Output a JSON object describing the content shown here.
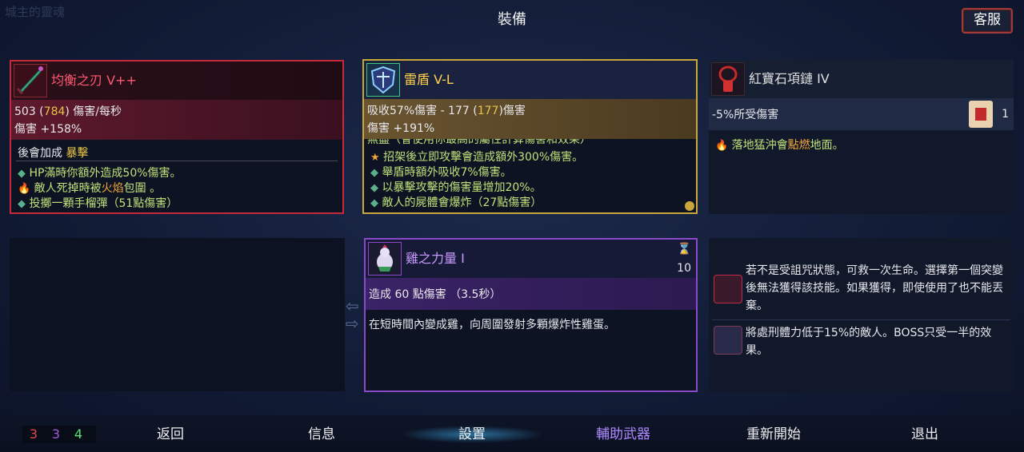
{
  "ghost_title": "城主的靈魂",
  "screen_title": "裝備",
  "support_button": "客服",
  "weapon": {
    "name": "均衡之刃 V++",
    "dps_base": "503",
    "dps_open": " (",
    "dps_value": "784",
    "dps_close": ") 傷害/每秒",
    "damage_bonus": "傷害 +158%",
    "bonus_label": "後會加成 ",
    "bonus_value": "暴擊",
    "effects": [
      {
        "prefix": "HP滿時你額外造成50%傷害。",
        "hl": "",
        "suffix": ""
      },
      {
        "prefix": "敵人死掉時被",
        "hl": "火焰",
        "suffix": "包圍 。"
      },
      {
        "prefix": "投擲一顆手榴彈（51點傷害）",
        "hl": "",
        "suffix": ""
      }
    ]
  },
  "shield": {
    "name": "雷盾 V-L",
    "absorb_a": "吸收57%傷害 - 177 (",
    "absorb_value": "177",
    "absorb_b": ")傷害",
    "damage_bonus": "傷害 +191%",
    "cutoff_line": "無盡（會使用你最高的屬性計算傷害和效果）",
    "effects": [
      "招架後立即攻擊會造成額外300%傷害。",
      "舉盾時額外吸收7%傷害。",
      "以暴擊攻擊的傷害量增加20%。",
      "敵人的屍體會爆炸（27點傷害）"
    ]
  },
  "amulet": {
    "name": "紅寶石項鏈 IV",
    "stat": "-5%所受傷害",
    "scroll_count": "1",
    "effect_a": "落地猛沖會",
    "effect_hl": "點燃",
    "effect_b": "地面。"
  },
  "skill": {
    "name": "雞之力量 I",
    "cooldown": "10",
    "damage": "造成 60 點傷害 （3.5秒）",
    "description": "在短時間內變成雞，向周圍發射多顆爆炸性雞蛋。"
  },
  "mutations": [
    {
      "text": "若不是受詛咒狀態，可救一次生命。選擇第一個突變後無法獲得該技能。如果獲得，即使使用了也不能丟棄。",
      "icon": "heart-mutation-icon"
    },
    {
      "text": "將處刑體力低于15%的敵人。BOSS只受一半的效果。",
      "icon": "execute-mutation-icon"
    }
  ],
  "scroll_counts": {
    "red": "3",
    "purple": "3",
    "green": "4"
  },
  "nav": [
    "返回",
    "信息",
    "設置",
    "輔助武器",
    "重新開始",
    "退出"
  ],
  "colors": {
    "weapon_border": "#c42a3a",
    "shield_border": "#c8a83c",
    "skill_border": "#8a4ac8",
    "highlight": "#e8c448"
  }
}
